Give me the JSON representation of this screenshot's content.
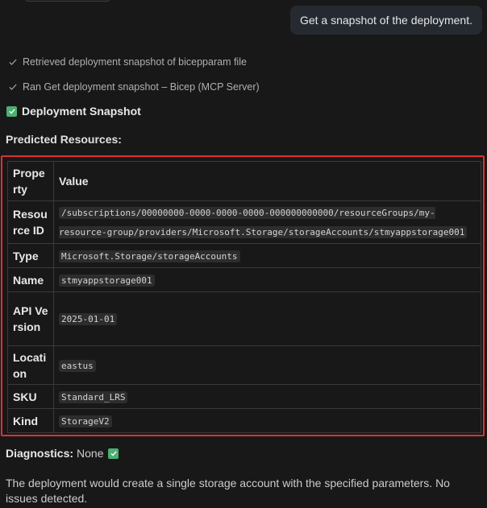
{
  "user_message": "Get a snapshot of the deployment.",
  "progress": [
    {
      "icon": "check-icon",
      "text": "Retrieved deployment snapshot of bicepparam file"
    },
    {
      "icon": "check-icon",
      "text": "Ran Get deployment snapshot – Bicep (MCP Server)"
    }
  ],
  "snapshot_heading": "Deployment Snapshot",
  "predicted_label": "Predicted Resources:",
  "table": {
    "headers": [
      "Property",
      "Value"
    ],
    "rows": [
      {
        "key": "Resource ID",
        "value": "/subscriptions/00000000-0000-0000-0000-000000000000/resourceGroups/my-resource-group/providers/Microsoft.Storage/storageAccounts/stmyappstorage001"
      },
      {
        "key": "Type",
        "value": "Microsoft.Storage/storageAccounts"
      },
      {
        "key": "Name",
        "value": "stmyappstorage001"
      },
      {
        "key": "API Version",
        "value": "2025-01-01"
      },
      {
        "key": "Location",
        "value": "eastus"
      },
      {
        "key": "SKU",
        "value": "Standard_LRS"
      },
      {
        "key": "Kind",
        "value": "StorageV2"
      }
    ]
  },
  "diagnostics": {
    "label": "Diagnostics:",
    "value": "None"
  },
  "summary": "The deployment would create a single storage account with the specified parameters. No issues detected.",
  "colors": {
    "accent_check": "#4caf73",
    "highlight_border": "#e03030"
  }
}
